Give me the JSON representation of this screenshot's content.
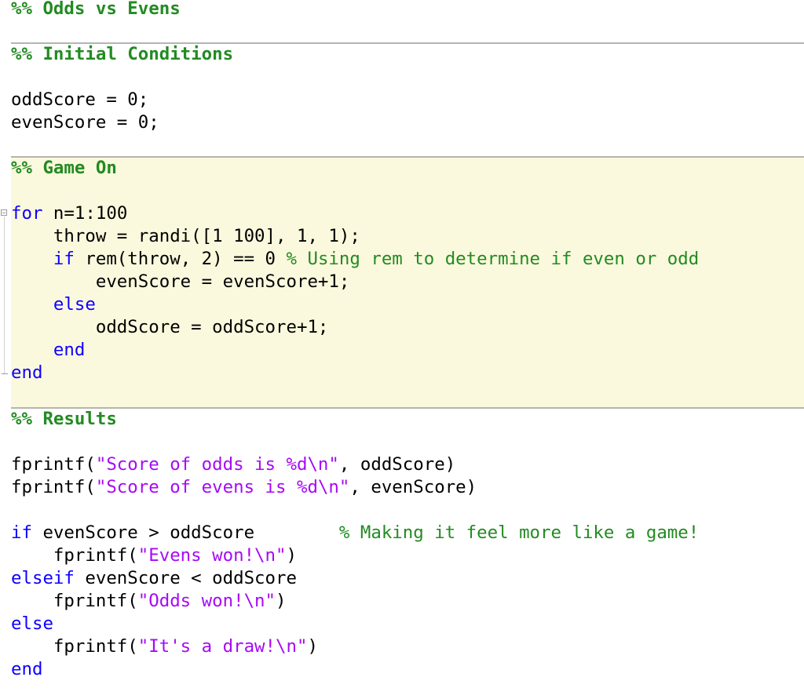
{
  "editor": {
    "sections": [
      {
        "title": "%% Odds vs Evens"
      },
      {
        "title": "%% Initial Conditions"
      },
      {
        "title": "%% Game On"
      },
      {
        "title": "%% Results"
      }
    ],
    "lines": {
      "init_1": "oddScore = 0;",
      "init_2": "evenScore = 0;",
      "for_kw": "for",
      "for_rest": " n=1:100",
      "throw": "    throw = randi([1 100], 1, 1);",
      "if_indent": "    ",
      "if_kw": "if",
      "if_rest": " rem(throw, 2) == 0 ",
      "if_comment": "% Using rem to determine if even or odd",
      "even_inc": "        evenScore = evenScore+1;",
      "else_indent": "    ",
      "else_kw": "else",
      "odd_inc": "        oddScore = oddScore+1;",
      "end_inner_indent": "    ",
      "end_inner_kw": "end",
      "end_outer_kw": "end",
      "fprintf1_pre": "fprintf(",
      "fprintf1_str": "\"Score of odds is %d\\n\"",
      "fprintf1_post": ", oddScore)",
      "fprintf2_pre": "fprintf(",
      "fprintf2_str": "\"Score of evens is %d\\n\"",
      "fprintf2_post": ", evenScore)",
      "if2_kw": "if",
      "if2_rest": " evenScore > oddScore        ",
      "if2_comment": "% Making it feel more like a game!",
      "evens_won_pre": "    fprintf(",
      "evens_won_str": "\"Evens won!\\n\"",
      "evens_won_post": ")",
      "elseif_kw": "elseif",
      "elseif_rest": " evenScore < oddScore",
      "odds_won_pre": "    fprintf(",
      "odds_won_str": "\"Odds won!\\n\"",
      "odds_won_post": ")",
      "else2_kw": "else",
      "draw_pre": "    fprintf(",
      "draw_str": "\"It's a draw!\\n\"",
      "draw_post": ")",
      "end2_kw": "end"
    },
    "colors": {
      "keyword": "#0e00ff",
      "string": "#a709f5",
      "comment": "#228b22",
      "active_cell_bg": "#fbf9dd",
      "divider": "#b4b4b4"
    }
  }
}
